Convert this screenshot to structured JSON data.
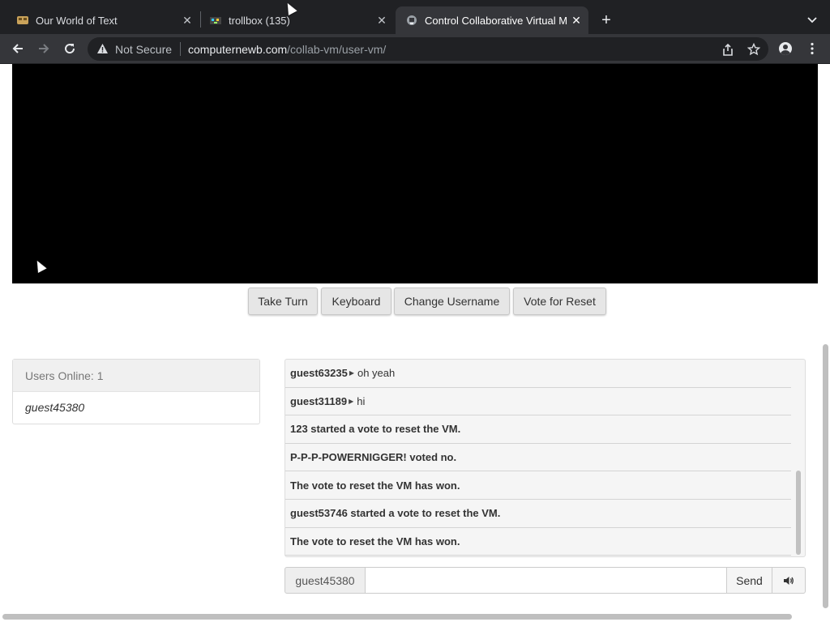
{
  "browser": {
    "tabs": [
      {
        "title": "Our World of Text",
        "favicon": "owot-icon",
        "active": false
      },
      {
        "title": "trollbox (135)",
        "favicon": "trollbox-icon",
        "active": false
      },
      {
        "title": "Control Collaborative Virtual M",
        "favicon": "collabvm-icon",
        "active": true
      }
    ],
    "close_glyph": "✕",
    "new_tab_glyph": "+",
    "tab_menu_glyph": "⌄",
    "security_label": "Not Secure",
    "url_host": "computernewb.com",
    "url_path": "/collab-vm/user-vm/"
  },
  "vm": {
    "buttons": {
      "take_turn": "Take Turn",
      "keyboard": "Keyboard",
      "change_username": "Change Username",
      "vote_reset": "Vote for Reset"
    }
  },
  "users": {
    "header": "Users Online: 1",
    "list": [
      "guest45380"
    ]
  },
  "chat": {
    "messages": [
      {
        "user": "guest63235",
        "text": "oh yeah"
      },
      {
        "user": "guest31189",
        "text": "hi"
      },
      {
        "system": "123 started a vote to reset the VM."
      },
      {
        "system": "P-P-P-POWERNIGGER! voted no."
      },
      {
        "system": "The vote to reset the VM has won."
      },
      {
        "system": "guest53746 started a vote to reset the VM."
      },
      {
        "system": "The vote to reset the VM has won."
      }
    ],
    "username": "guest45380",
    "input_value": "",
    "send_label": "Send",
    "sound_icon": "speaker-icon"
  }
}
